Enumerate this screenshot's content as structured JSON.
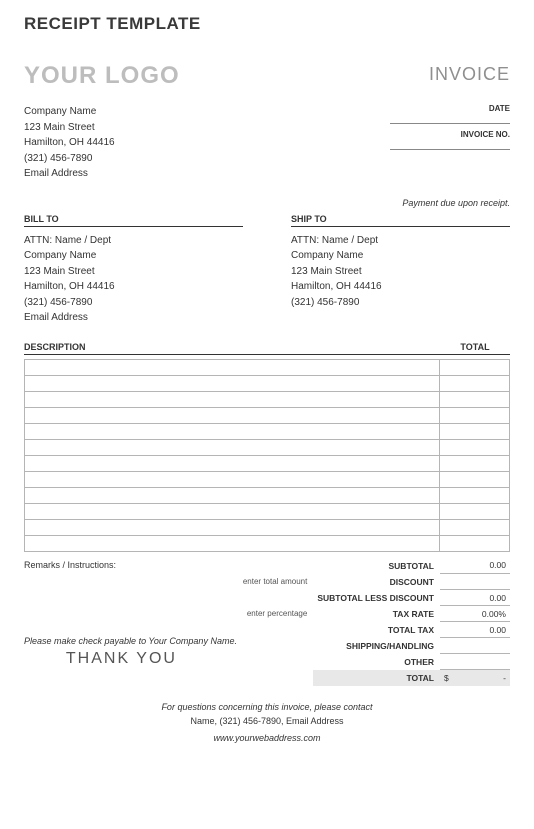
{
  "page_title": "RECEIPT TEMPLATE",
  "logo_text": "YOUR LOGO",
  "invoice_heading": "INVOICE",
  "company": {
    "name": "Company Name",
    "street": "123 Main Street",
    "city": "Hamilton, OH  44416",
    "phone": "(321) 456-7890",
    "email": "Email Address"
  },
  "meta": {
    "date_label": "DATE",
    "invoice_no_label": "INVOICE NO."
  },
  "payment_due": "Payment due upon receipt.",
  "bill_to": {
    "header": "BILL TO",
    "attn": "ATTN: Name / Dept",
    "company": "Company Name",
    "street": "123 Main Street",
    "city": "Hamilton, OH  44416",
    "phone": "(321) 456-7890",
    "email": "Email Address"
  },
  "ship_to": {
    "header": "SHIP TO",
    "attn": "ATTN: Name / Dept",
    "company": "Company Name",
    "street": "123 Main Street",
    "city": "Hamilton, OH  44416",
    "phone": "(321) 456-7890"
  },
  "table": {
    "description_header": "DESCRIPTION",
    "total_header": "TOTAL",
    "row_count": 12
  },
  "remarks_label": "Remarks / Instructions:",
  "payable_text": "Please make check payable to Your Company Name.",
  "thank_you": "THANK YOU",
  "summary": {
    "subtotal": {
      "label": "SUBTOTAL",
      "value": "0.00"
    },
    "discount": {
      "hint": "enter total amount",
      "label": "DISCOUNT",
      "value": ""
    },
    "subtotal_less": {
      "label": "SUBTOTAL LESS DISCOUNT",
      "value": "0.00"
    },
    "tax_rate": {
      "hint": "enter percentage",
      "label": "TAX RATE",
      "value": "0.00%"
    },
    "total_tax": {
      "label": "TOTAL TAX",
      "value": "0.00"
    },
    "shipping": {
      "label": "SHIPPING/HANDLING",
      "value": ""
    },
    "other": {
      "label": "OTHER",
      "value": ""
    },
    "total": {
      "label": "TOTAL",
      "currency": "$",
      "value": "-"
    }
  },
  "footer": {
    "question": "For questions concerning this invoice, please contact",
    "contact": "Name, (321) 456-7890, Email Address",
    "web": "www.yourwebaddress.com"
  }
}
